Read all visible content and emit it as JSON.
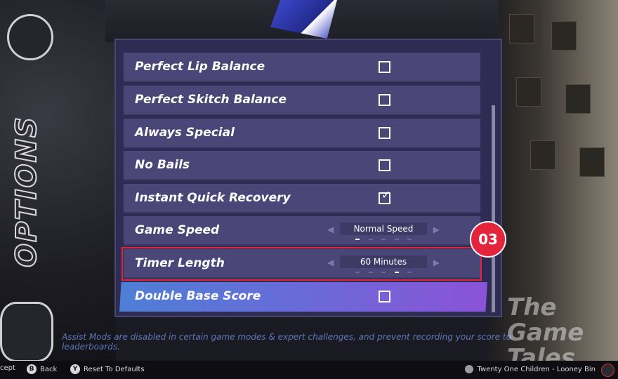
{
  "side_title": "OPTIONS",
  "settings": [
    {
      "label": "Perfect Lip Balance",
      "type": "checkbox",
      "checked": false
    },
    {
      "label": "Perfect Skitch Balance",
      "type": "checkbox",
      "checked": false
    },
    {
      "label": "Always Special",
      "type": "checkbox",
      "checked": false
    },
    {
      "label": "No Bails",
      "type": "checkbox",
      "checked": false
    },
    {
      "label": "Instant Quick Recovery",
      "type": "checkbox",
      "checked": true
    },
    {
      "label": "Game Speed",
      "type": "selector",
      "value": "Normal Speed"
    },
    {
      "label": "Timer Length",
      "type": "selector",
      "value": "60 Minutes"
    },
    {
      "label": "Double Base Score",
      "type": "checkbox",
      "checked": false
    }
  ],
  "highlighted_row": "Double Base Score",
  "callout": {
    "label": "03",
    "target": "Timer Length"
  },
  "note": "Assist Mods are disabled in certain game modes & expert challenges, and prevent recording your score to leaderboards.",
  "footer": {
    "accept_label": "cept",
    "back_key": "B",
    "back_label": "Back",
    "reset_key": "Y",
    "reset_label": "Reset To Defaults",
    "now_playing": "Twenty One Children - Looney Bin"
  },
  "watermark": {
    "line1": "The",
    "line2": "Game",
    "line3": "Tales"
  },
  "colors": {
    "row": "#4a4677",
    "panel": "#2e2c52",
    "highlight_start": "#4e7fd6",
    "highlight_end": "#8b53d8",
    "callout": "#e3243b",
    "note": "#5c78b8"
  }
}
